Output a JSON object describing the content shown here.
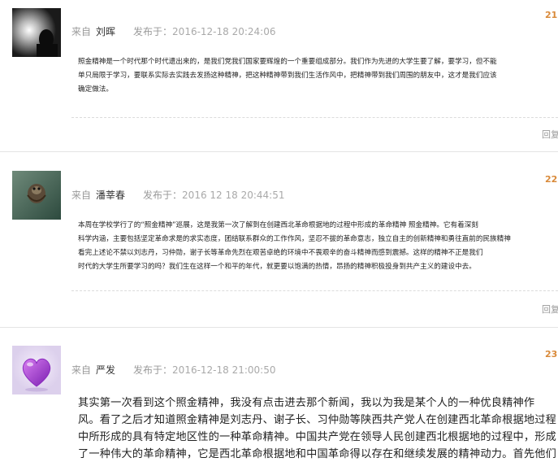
{
  "comments": [
    {
      "source_label": "来自",
      "author": "刘晖",
      "time_label": "发布于：",
      "time": "2016-12-18 20:24:06",
      "floor": "21",
      "reply_label": "回复",
      "body": "照金精神是一个时代那个时代遗出来的，是我们党我们国家要辉煌的一个重要组成部分。我们作为先进的大学生要了解，要学习，但不能\n单只局限于学习，要联系实际去实践去发扬这种精神，把这种精神带到我们生活作风中，把精神带到我们周围的朋友中，这才是我们应该\n确定做法。"
    },
    {
      "source_label": "来自",
      "author": "潘莘春",
      "time_label": "发布于：",
      "time": "2016 12 18 20:44:51",
      "floor": "22",
      "reply_label": "回复",
      "body": "本周在学校学行了的“照金精神”巡展，这是我第一次了解到在创建西北革命根据地的过程中形成的革命精神       照金精神。它有着深刻\n科学内涵，主要包括坚定革命求是的求实态度，团结联系群众的工作作风，坚忍不拔的革命意志，独立自主的创新精神和勇往直前的民族精神\n看完上述论不禁以刘志丹，习仲勋，谢子长等革命先烈在艰苦卓绝的环境中不畏艰辛的奋斗精神而感到震撼。这样的精神不正是我们\n时代的大学生所要学习的吗？我们生在这样一个和平的年代，就更要以饱满的热情，昂扬的精神积极投身到共产主义的建设中去。"
    },
    {
      "source_label": "来自",
      "author": "严发",
      "time_label": "发布于：",
      "time": "2016-12-18 21:00:50",
      "floor": "23",
      "reply_label": "回复",
      "body": "        其实第一次看到这个照金精神，我没有点击进去那个新闻，我以为我是某个人的一种优良精神作\n风。看了之后才知道照金精神是刘志丹、谢子长、习仲勋等陕西共产党人在创建西北革命根据地过程\n中所形成的具有特定地区性的一种革命精神。中国共产党在领导人民创建西北根据地的过程中，形成\n了一种伟大的革命精神，它是西北革命根据地和中国革命得以存在和继续发展的精神动力。首先他们\n在那里创办的陕甘革命根据地，游击队，等等，不畏一切艰难险阻，把革命进行到底，能进行到底的"
    }
  ],
  "colors": {
    "accent": "#d98a3a",
    "meta": "#9a9a9a",
    "separator": "#e4e4e4"
  }
}
